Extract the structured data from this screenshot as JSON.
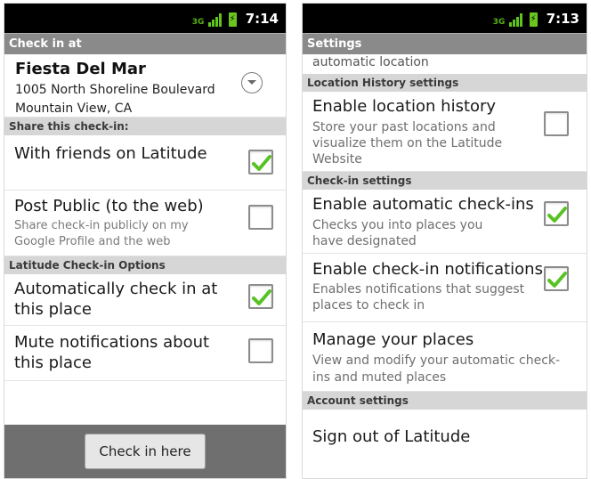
{
  "left": {
    "status": {
      "network": "3G",
      "time": "7:14"
    },
    "title": "Check in at",
    "venue": {
      "name": "Fiesta Del Mar",
      "address1": "1005 North Shoreline Boulevard",
      "address2": "Mountain View, CA",
      "expand_icon": "chevron-down-icon"
    },
    "share_header": "Share this check-in:",
    "share_items": [
      {
        "label": "With friends on Latitude",
        "checked": true
      },
      {
        "label": "Post Public (to the web)",
        "sub": "Share check-in publicly on my Google Profile and the web",
        "checked": false
      }
    ],
    "options_header": "Latitude Check-in Options",
    "options_items": [
      {
        "label": "Automatically check in at this place",
        "checked": true
      },
      {
        "label": "Mute notifications about this place",
        "checked": false
      }
    ],
    "button": "Check in here"
  },
  "right": {
    "status": {
      "network": "3G",
      "time": "7:13"
    },
    "title": "Settings",
    "partial_text": "automatic location",
    "location_header": "Location History settings",
    "location_item": {
      "label": "Enable location history",
      "sub": "Store your past locations and visualize them on the Latitude Website",
      "checked": false
    },
    "checkin_header": "Check-in settings",
    "checkin_items": [
      {
        "label": "Enable automatic check-ins",
        "sub": "Checks you into places you have designated",
        "checked": true
      },
      {
        "label": "Enable check-in notifications",
        "sub": "Enables notifications that suggest places to check in",
        "checked": true
      }
    ],
    "manage_item": {
      "label": "Manage your places",
      "sub": "View and modify your automatic check-ins and muted places"
    },
    "account_header": "Account settings",
    "signout": "Sign out of Latitude"
  },
  "colors": {
    "check_green": "#57c323",
    "titlebar": "#8a8a8a",
    "section": "#d6d6d6"
  }
}
